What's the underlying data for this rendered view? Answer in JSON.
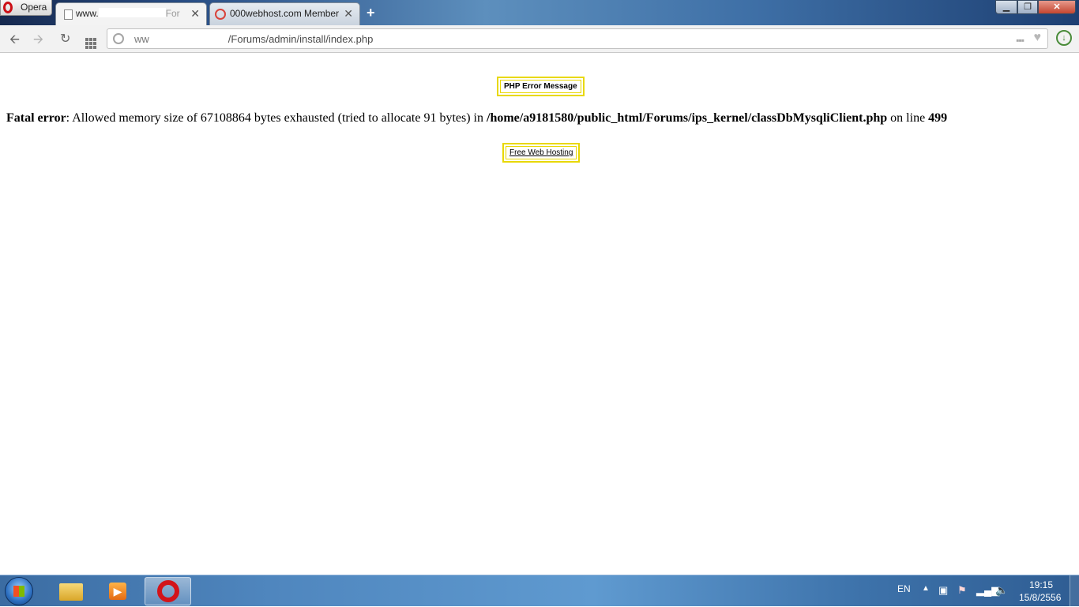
{
  "browser": {
    "menu_label": "Opera",
    "tabs": [
      {
        "title_start": "www.",
        "title_tail": "For",
        "close": "✕"
      },
      {
        "title": "000webhost.com Member",
        "close": "✕"
      }
    ],
    "new_tab": "+",
    "window_controls": {
      "minimize": "▁",
      "maximize": "❐",
      "close": "✕"
    },
    "address": {
      "prefix": "ww",
      "path": "/Forums/admin/install/index.php"
    }
  },
  "page": {
    "php_error_box": "PHP Error Message",
    "fatal": {
      "label": "Fatal error",
      "message": ": Allowed memory size of 67108864 bytes exhausted (tried to allocate 91 bytes) in ",
      "file": "/home/a9181580/public_html/Forums/ips_kernel/classDbMysqliClient.php",
      "on_line": " on line ",
      "line": "499"
    },
    "hosting_link": "Free Web Hosting"
  },
  "taskbar": {
    "apps": [
      "windows-explorer",
      "media-player",
      "opera"
    ],
    "language": "EN",
    "time": "19:15",
    "date": "15/8/2556"
  }
}
